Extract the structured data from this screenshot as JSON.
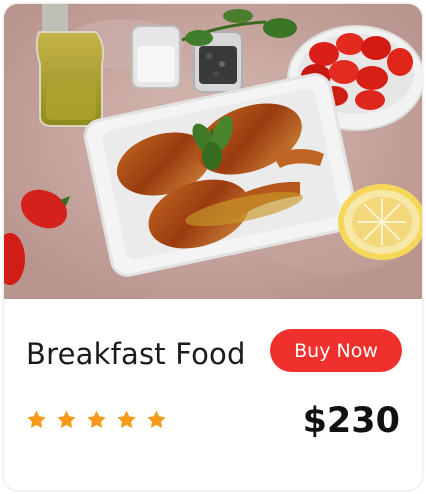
{
  "card": {
    "image_alt": "Glazed chicken drumsticks on a white dish with tomatoes, oil and spices",
    "title": "Breakfast Food",
    "buy_label": "Buy Now",
    "price": "$230",
    "rating": 5,
    "rating_max": 5
  },
  "colors": {
    "accent": "#f0302c",
    "star": "#f79a1a"
  }
}
